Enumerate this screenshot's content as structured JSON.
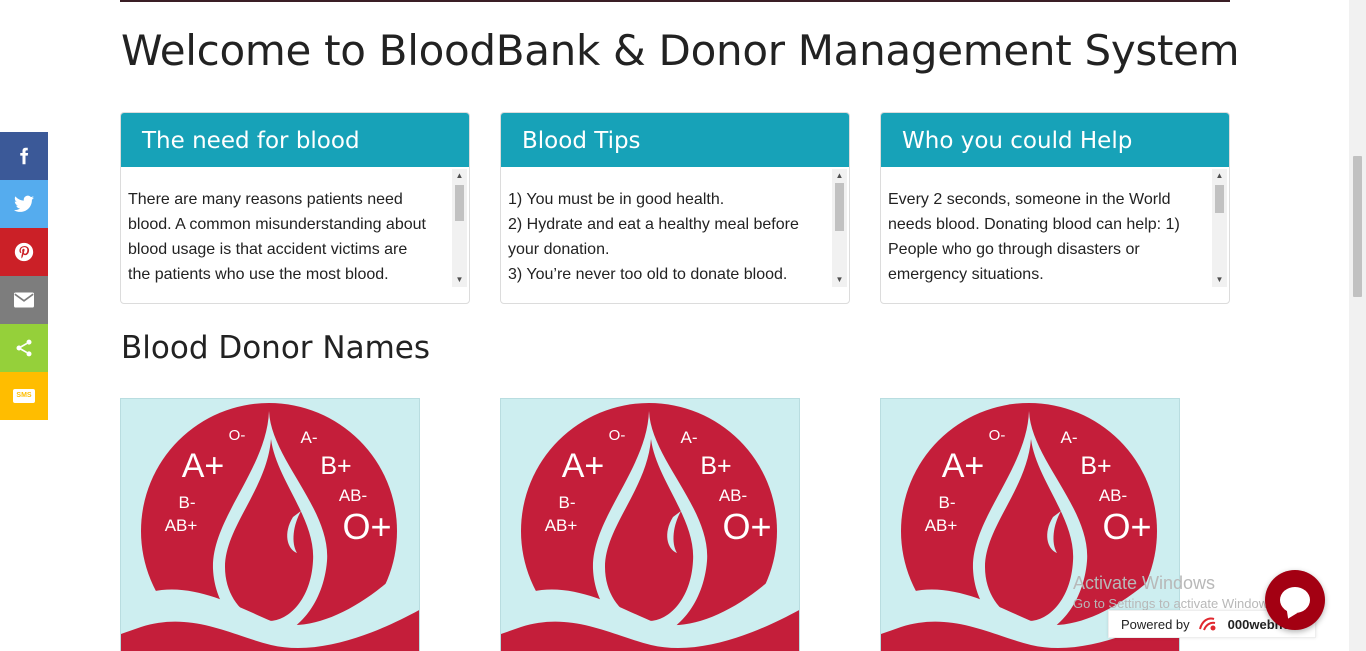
{
  "page": {
    "title": "Welcome to BloodBank & Donor Management System",
    "section_title": "Blood Donor Names"
  },
  "cards": [
    {
      "heading": "The need for blood",
      "lines": [
        "There are many reasons patients need",
        "blood. A common misunderstanding about",
        "blood usage is that accident victims are",
        "the patients who use the most blood."
      ]
    },
    {
      "heading": "Blood Tips",
      "lines": [
        "1) You must be in good health.",
        "2) Hydrate and eat a healthy meal before",
        "your donation.",
        "3) You’re never too old to donate blood."
      ]
    },
    {
      "heading": "Who you could Help",
      "lines": [
        "Every 2 seconds, someone in the World",
        "needs blood. Donating blood can help: 1)",
        "People who go through disasters or",
        "emergency situations."
      ]
    }
  ],
  "donor_logo": {
    "blood_types": [
      "A+",
      "O-",
      "A-",
      "B+",
      "B-",
      "AB-",
      "AB+",
      "O+"
    ]
  },
  "share_bar": {
    "icons": [
      "facebook-icon",
      "twitter-icon",
      "pinterest-icon",
      "email-icon",
      "share-icon",
      "sms-icon"
    ],
    "sms_label": "SMS"
  },
  "watermark": {
    "line1": "Activate Windows",
    "line2": "Go to Settings to activate Windows."
  },
  "powered": {
    "label": "Powered by",
    "brand": "000webhost"
  },
  "colors": {
    "header_teal": "#17a2b8",
    "blood_red": "#c41e3a",
    "logo_bg": "#cdeef0",
    "chat_red": "#a30012"
  }
}
